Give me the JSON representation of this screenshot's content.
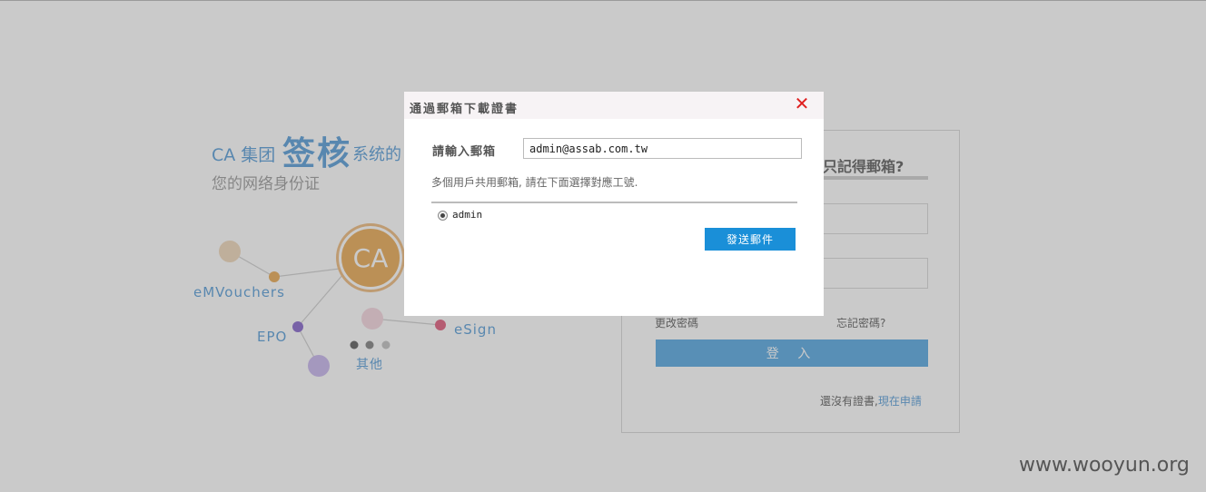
{
  "brand": {
    "ca_group": "CA 集团",
    "big_title": "签核",
    "system_suffix": "系统的",
    "subtitle": "您的网络身份证"
  },
  "diagram": {
    "center": "CA",
    "nodes": [
      "eMVouchers",
      "EPO",
      "eSign",
      "其他"
    ]
  },
  "login": {
    "title_fragment": "只記得郵箱?",
    "change_password": "更改密碼",
    "forgot_password": "忘記密碼?",
    "login_button": "登 入",
    "no_cert_text": "還沒有證書,",
    "apply_now": "現在申請"
  },
  "dialog": {
    "title": "通過郵箱下載證書",
    "close_symbol": "✕",
    "email_label": "請輸入郵箱",
    "email_value": "admin@assab.com.tw",
    "note": "多個用戶共用郵箱, 請在下面選擇對應工號.",
    "options": [
      {
        "label": "admin",
        "selected": true
      }
    ],
    "send_button": "發送郵件"
  },
  "watermark": "www.wooyun.org",
  "colors": {
    "accent_blue": "#1a78c8",
    "button_blue": "#1a8fd8",
    "ca_orange": "#e08a17",
    "close_red": "#e02020"
  }
}
